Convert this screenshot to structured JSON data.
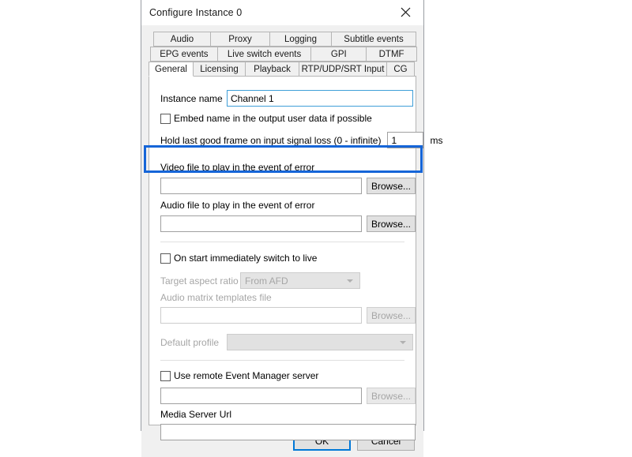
{
  "window": {
    "title": "Configure Instance 0",
    "close_icon": "close-icon"
  },
  "tabs": {
    "row1": [
      {
        "label": "Audio",
        "selected": false
      },
      {
        "label": "Proxy",
        "selected": false
      },
      {
        "label": "Logging",
        "selected": false
      },
      {
        "label": "Subtitle events",
        "selected": false
      }
    ],
    "row2": [
      {
        "label": "EPG events",
        "selected": false
      },
      {
        "label": "Live switch events",
        "selected": false
      },
      {
        "label": "GPI",
        "selected": false
      },
      {
        "label": "DTMF",
        "selected": false
      }
    ],
    "row3": [
      {
        "label": "General",
        "selected": true
      },
      {
        "label": "Licensing",
        "selected": false
      },
      {
        "label": "Playback",
        "selected": false
      },
      {
        "label": "RTP/UDP/SRT Input",
        "selected": false
      },
      {
        "label": "CG",
        "selected": false
      }
    ]
  },
  "general": {
    "instance_name_label": "Instance name",
    "instance_name_value": "Channel 1",
    "embed_name_checkbox": "Embed name in the output user data if possible",
    "hold_frame_label": "Hold last good frame on input signal loss (0 - infinite)",
    "hold_frame_value": "1",
    "hold_frame_unit": "ms",
    "video_file_label": "Video file to play in the event of error",
    "video_file_value": "",
    "video_browse_label": "Browse...",
    "audio_file_label": "Audio file to play in the event of error",
    "audio_file_value": "",
    "audio_browse_label": "Browse...",
    "switch_to_live_checkbox": "On start immediately switch to live",
    "target_aspect_label": "Target aspect ratio",
    "target_aspect_value": "From AFD",
    "audio_matrix_label": "Audio matrix templates file",
    "audio_matrix_value": "",
    "audio_matrix_browse_label": "Browse...",
    "default_profile_label": "Default profile",
    "default_profile_value": "",
    "remote_event_checkbox": "Use remote Event Manager server",
    "remote_event_value": "",
    "remote_event_browse_label": "Browse...",
    "media_server_label": "Media Server Url",
    "media_server_value": ""
  },
  "footer": {
    "ok_label": "OK",
    "cancel_label": "Cancel"
  },
  "annotation": {
    "highlight_color": "#1565d8",
    "accent_color": "#0078d7"
  }
}
